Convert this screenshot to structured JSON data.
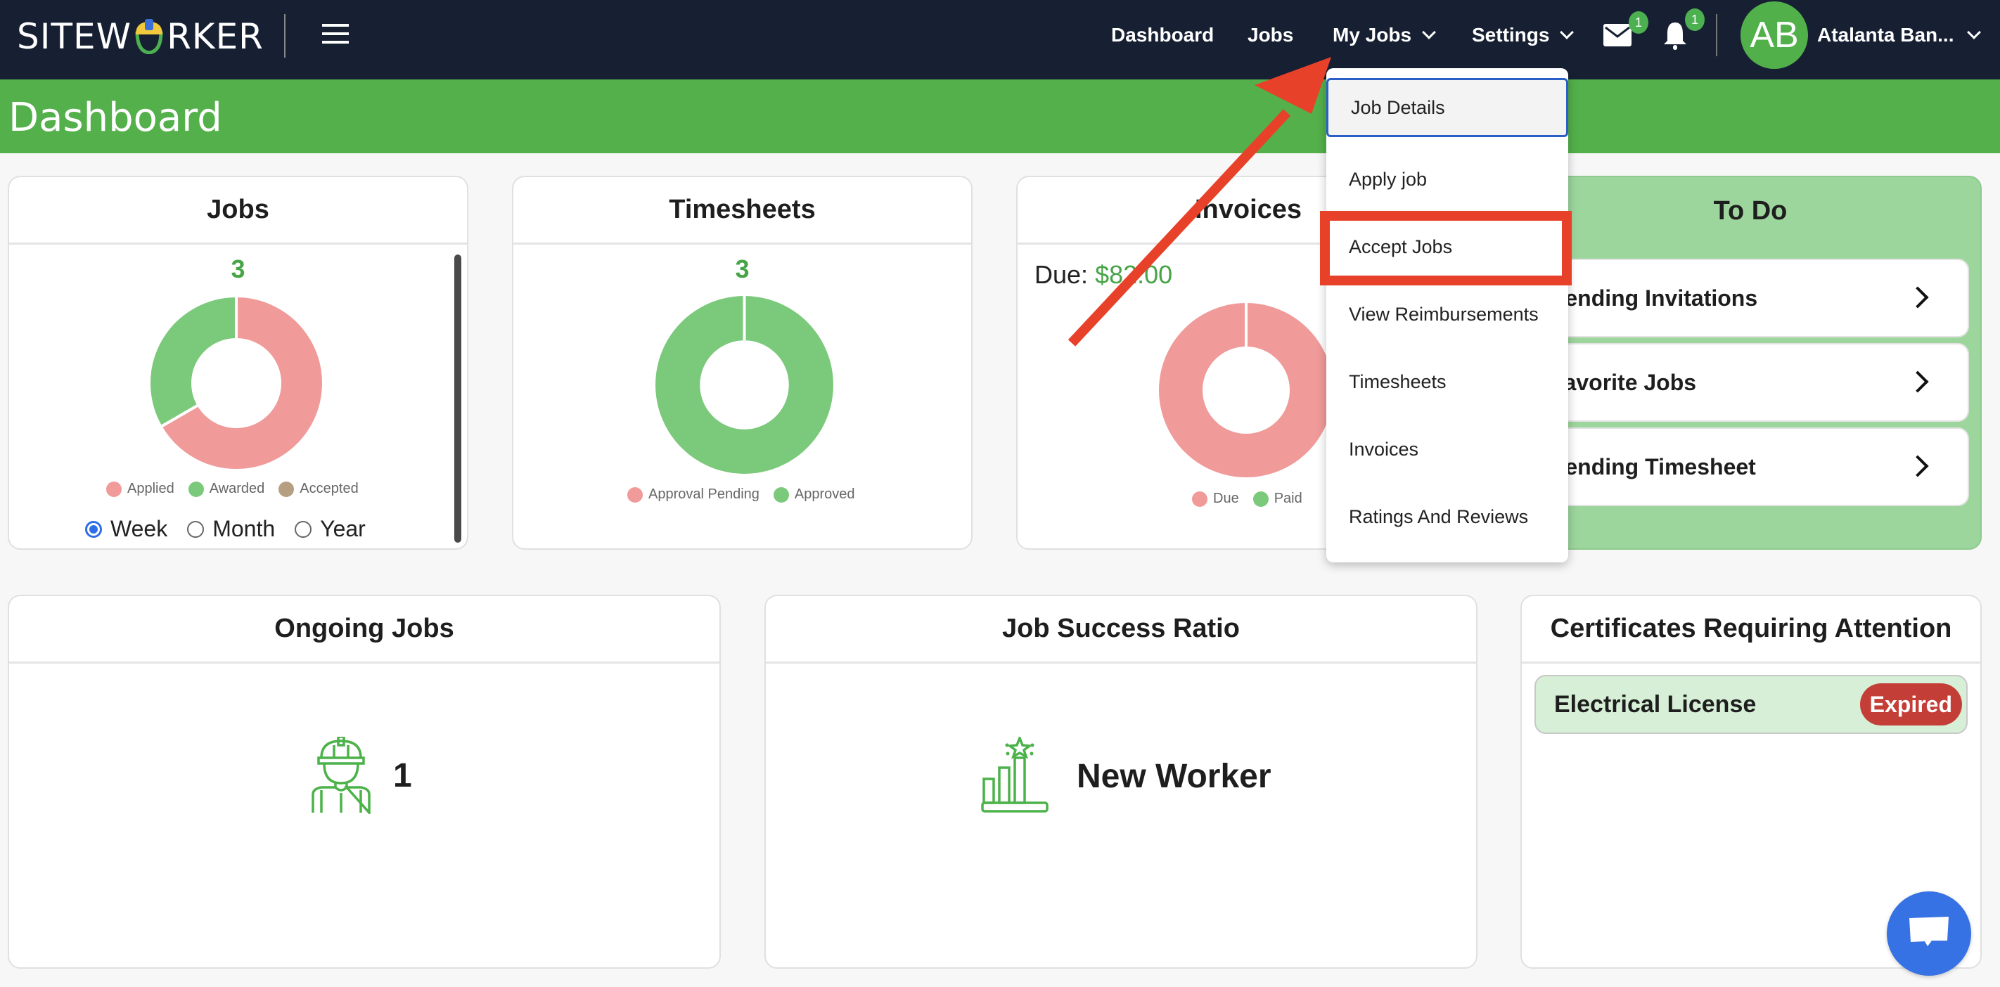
{
  "brand": {
    "logo_text_left": "SITEW",
    "logo_text_right": "RKER"
  },
  "nav": {
    "items": [
      {
        "label": "Dashboard",
        "has_dropdown": false
      },
      {
        "label": "Jobs",
        "has_dropdown": false
      },
      {
        "label": "My Jobs",
        "has_dropdown": true
      },
      {
        "label": "Settings",
        "has_dropdown": true
      }
    ],
    "messages_badge": "1",
    "notifications_badge": "1",
    "user": {
      "initials": "AB",
      "name": "Atalanta Ban..."
    }
  },
  "page": {
    "title": "Dashboard"
  },
  "colors": {
    "header_bg": "#172033",
    "brand_green": "#53b04a",
    "pink": "#f09a99",
    "green": "#7bc97b",
    "tan": "#b59f80",
    "expired_red": "#c43e38",
    "annotation_red": "#e8412a",
    "chat_blue": "#3672e4"
  },
  "cards": {
    "jobs": {
      "title": "Jobs",
      "total": "3",
      "legend": [
        "Applied",
        "Awarded",
        "Accepted"
      ],
      "period_options": [
        "Week",
        "Month",
        "Year"
      ],
      "selected_period": "Week"
    },
    "timesheets": {
      "title": "Timesheets",
      "total": "3",
      "legend": [
        "Approval Pending",
        "Approved"
      ]
    },
    "invoices": {
      "title": "Invoices",
      "due_label": "Due:",
      "due_amount": "$82.00",
      "legend": [
        "Due",
        "Paid"
      ]
    },
    "todo": {
      "title": "To Do",
      "items": [
        "Pending Invitations",
        "Favorite Jobs",
        "Pending Timesheet"
      ]
    },
    "ongoing_jobs": {
      "title": "Ongoing Jobs",
      "value": "1"
    },
    "job_success": {
      "title": "Job Success Ratio",
      "value": "New Worker"
    },
    "certificates": {
      "title": "Certificates Requiring Attention",
      "items": [
        {
          "name": "Electrical License",
          "status": "Expired"
        }
      ]
    }
  },
  "my_jobs_menu": {
    "items": [
      "Job Details",
      "Apply job",
      "Accept Jobs",
      "View Reimbursements",
      "Timesheets",
      "Invoices",
      "Ratings And Reviews"
    ],
    "focused": "Job Details",
    "highlighted": "Accept Jobs"
  },
  "chart_data": [
    {
      "type": "pie",
      "title": "Jobs",
      "categories": [
        "Applied",
        "Awarded",
        "Accepted"
      ],
      "values": [
        2,
        1,
        0
      ],
      "colors": [
        "#f09a99",
        "#7bc97b",
        "#b59f80"
      ],
      "donut": true,
      "legend": "bottom"
    },
    {
      "type": "pie",
      "title": "Timesheets",
      "categories": [
        "Approval Pending",
        "Approved"
      ],
      "values": [
        0,
        3
      ],
      "colors": [
        "#f09a99",
        "#7bc97b"
      ],
      "donut": true,
      "legend": "bottom"
    },
    {
      "type": "pie",
      "title": "Invoices",
      "categories": [
        "Due",
        "Paid"
      ],
      "values": [
        1,
        0
      ],
      "colors": [
        "#f09a99",
        "#7bc97b"
      ],
      "donut": true,
      "legend": "bottom"
    }
  ]
}
